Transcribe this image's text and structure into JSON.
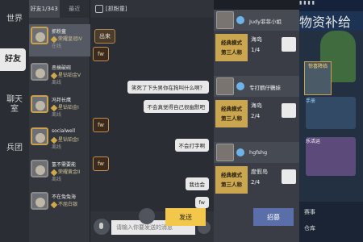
{
  "nav": {
    "world": "世界",
    "friends": "好友",
    "chatroom": "聊天室",
    "squad": "兵团"
  },
  "friends_panel": {
    "tab_friends": "好友1/343",
    "tab_recent": "最近",
    "list": [
      {
        "name": "抓粉童",
        "rank": "荣耀皇冠IV",
        "status": "在线"
      },
      {
        "name": "恶搞破碗",
        "rank": "星钻铂金V",
        "status": "离线"
      },
      {
        "name": "冯邦长鹰",
        "rank": "星钻铂金I",
        "status": "离线"
      },
      {
        "name": "socialwell",
        "rank": "星钻铂金I",
        "status": "离线"
      },
      {
        "name": "氢不需要能",
        "rank": "荣耀黄金II",
        "status": "离线"
      },
      {
        "name": "不在兔兔海",
        "rank": "不屈白银",
        "status": ""
      }
    ]
  },
  "chat": {
    "header": "[抓粉童]",
    "messages": [
      {
        "side": "left",
        "text": "出来",
        "type": "bubble"
      },
      {
        "side": "left",
        "text": "fw",
        "type": "badge"
      },
      {
        "side": "right",
        "text": "笑死了下头男你在狗叫什么啊？"
      },
      {
        "side": "right",
        "text": "不会真觉得自己很幽默吧"
      },
      {
        "side": "left",
        "text": "fw",
        "type": "badge"
      },
      {
        "side": "right",
        "text": "不会打字啊"
      },
      {
        "side": "left",
        "text": "fw",
        "type": "badge"
      },
      {
        "side": "right",
        "text": "我也会"
      },
      {
        "side": "right",
        "text": "fw"
      }
    ],
    "input_placeholder": "请输入你要发送的消息",
    "send": "发送"
  },
  "recruit": {
    "cards": [
      {
        "user": "Judy菲菲小姐",
        "mode": "经典模式\n第三人称",
        "map": "海岛",
        "count": "1/4"
      },
      {
        "user": "专打鹦仔鸚妹",
        "mode": "经典模式\n第三人称",
        "map": "海岛",
        "count": "2/4"
      },
      {
        "user": "hgfshg",
        "mode": "经典模式\n第三人称",
        "map": "度假岛",
        "count": "2/4"
      }
    ],
    "recruit_label": "招募"
  },
  "game": {
    "top": "▮ ▮ ▮ ▮",
    "gift": "物资补给",
    "box1": "惊喜降临",
    "box2": "手册",
    "event": "乐活运",
    "bottom1": "赛事",
    "bottom2": "仓库"
  }
}
